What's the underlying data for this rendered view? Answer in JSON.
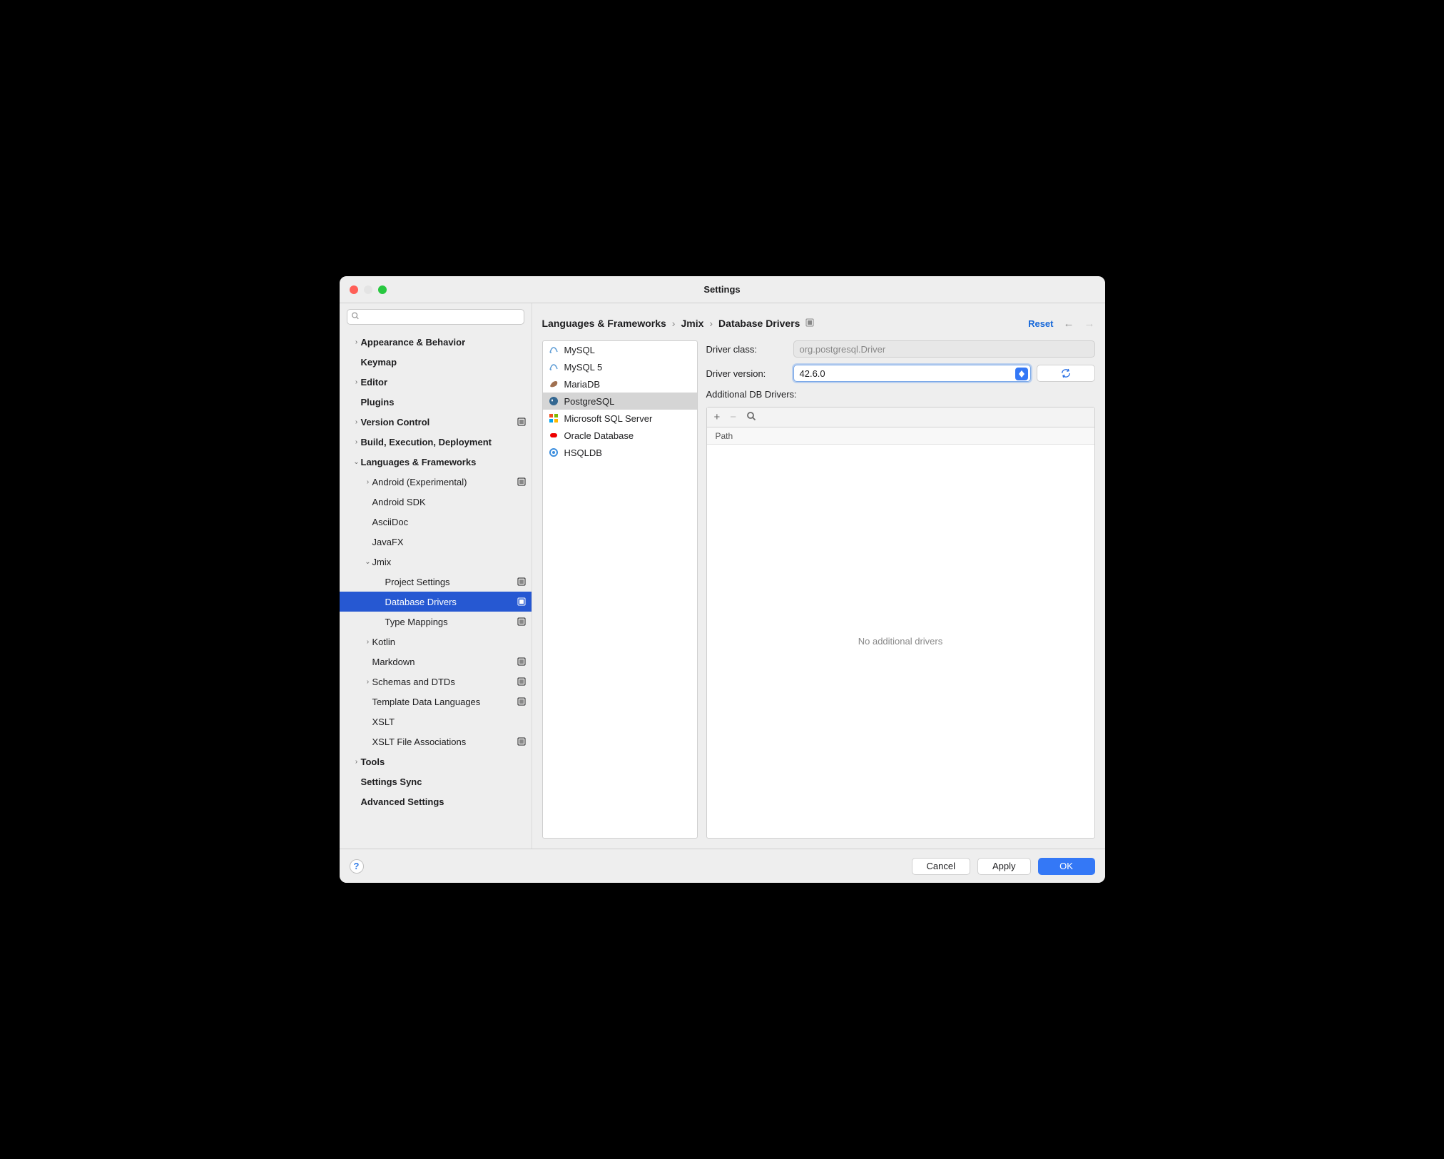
{
  "title": "Settings",
  "search": {
    "placeholder": ""
  },
  "sidebar": [
    {
      "label": "Appearance & Behavior",
      "bold": true,
      "chev": ">",
      "pad": "pad-0"
    },
    {
      "label": "Keymap",
      "bold": true,
      "pad": "pad-0b"
    },
    {
      "label": "Editor",
      "bold": true,
      "chev": ">",
      "pad": "pad-0"
    },
    {
      "label": "Plugins",
      "bold": true,
      "pad": "pad-0b"
    },
    {
      "label": "Version Control",
      "bold": true,
      "chev": ">",
      "pad": "pad-0",
      "ind": true
    },
    {
      "label": "Build, Execution, Deployment",
      "bold": true,
      "chev": ">",
      "pad": "pad-0"
    },
    {
      "label": "Languages & Frameworks",
      "bold": true,
      "chev": "v",
      "pad": "pad-0"
    },
    {
      "label": "Android (Experimental)",
      "chev": ">",
      "pad": "pad-1",
      "ind": true
    },
    {
      "label": "Android SDK",
      "pad": "pad-1b"
    },
    {
      "label": "AsciiDoc",
      "pad": "pad-1b"
    },
    {
      "label": "JavaFX",
      "pad": "pad-1b"
    },
    {
      "label": "Jmix",
      "chev": "v",
      "pad": "pad-1"
    },
    {
      "label": "Project Settings",
      "pad": "pad-2b",
      "ind": true
    },
    {
      "label": "Database Drivers",
      "pad": "pad-2b",
      "ind": true,
      "selected": true
    },
    {
      "label": "Type Mappings",
      "pad": "pad-2b",
      "ind": true
    },
    {
      "label": "Kotlin",
      "chev": ">",
      "pad": "pad-1"
    },
    {
      "label": "Markdown",
      "pad": "pad-1b",
      "ind": true
    },
    {
      "label": "Schemas and DTDs",
      "chev": ">",
      "pad": "pad-1",
      "ind": true
    },
    {
      "label": "Template Data Languages",
      "pad": "pad-1b",
      "ind": true
    },
    {
      "label": "XSLT",
      "pad": "pad-1b"
    },
    {
      "label": "XSLT File Associations",
      "pad": "pad-1b",
      "ind": true
    },
    {
      "label": "Tools",
      "bold": true,
      "chev": ">",
      "pad": "pad-0"
    },
    {
      "label": "Settings Sync",
      "bold": true,
      "pad": "pad-0b"
    },
    {
      "label": "Advanced Settings",
      "bold": true,
      "pad": "pad-0b"
    }
  ],
  "breadcrumb": {
    "parts": [
      "Languages & Frameworks",
      "Jmix",
      "Database Drivers"
    ],
    "reset": "Reset"
  },
  "drivers": [
    {
      "name": "MySQL",
      "icon": "mysql"
    },
    {
      "name": "MySQL 5",
      "icon": "mysql"
    },
    {
      "name": "MariaDB",
      "icon": "mariadb"
    },
    {
      "name": "PostgreSQL",
      "icon": "postgres",
      "selected": true
    },
    {
      "name": "Microsoft SQL Server",
      "icon": "mssql"
    },
    {
      "name": "Oracle Database",
      "icon": "oracle"
    },
    {
      "name": "HSQLDB",
      "icon": "hsqldb"
    }
  ],
  "form": {
    "driver_class_label": "Driver class:",
    "driver_class_value": "org.postgresql.Driver",
    "driver_version_label": "Driver version:",
    "driver_version_value": "42.6.0",
    "additional_label": "Additional DB Drivers:",
    "path_header": "Path",
    "empty_msg": "No additional drivers"
  },
  "footer": {
    "cancel": "Cancel",
    "apply": "Apply",
    "ok": "OK"
  }
}
